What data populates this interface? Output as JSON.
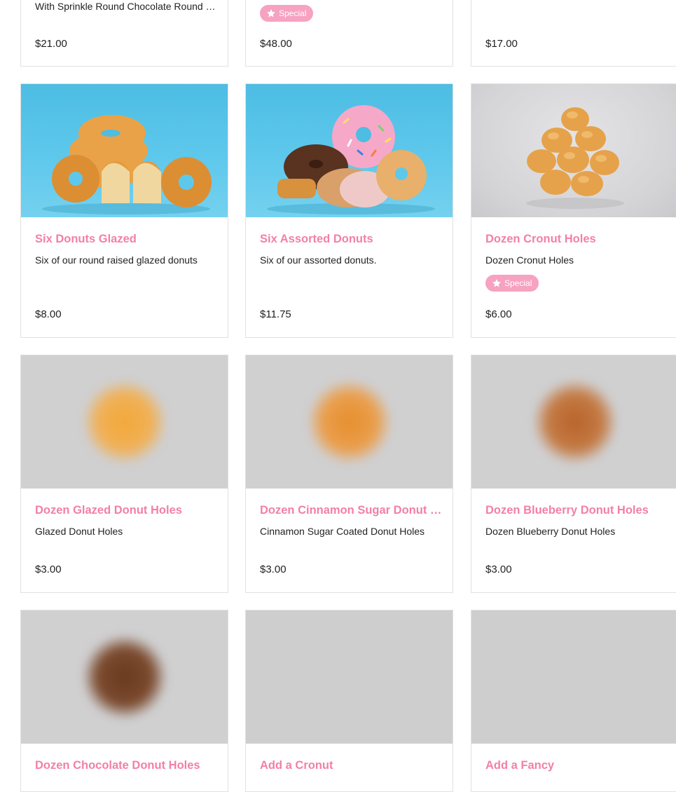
{
  "cards": {
    "c0": {
      "description": "With Sprinkle Round Chocolate Round Glazed Donuts",
      "price": "$21.00"
    },
    "c1": {
      "badge": "Special",
      "price": "$48.00"
    },
    "c2": {
      "price": "$17.00"
    },
    "c3": {
      "title": "Six Donuts Glazed",
      "description": "Six of our round raised glazed donuts",
      "price": "$8.00",
      "image": "glazed-donuts-photo"
    },
    "c4": {
      "title": "Six Assorted Donuts",
      "description": "Six of our assorted donuts.",
      "price": "$11.75",
      "image": "assorted-donuts-photo"
    },
    "c5": {
      "title": "Dozen Cronut Holes",
      "description": "Dozen Cronut Holes",
      "badge": "Special",
      "price": "$6.00",
      "image": "cronut-holes-photo"
    },
    "c6": {
      "title": "Dozen Glazed Donut Holes",
      "description": "Glazed Donut Holes",
      "price": "$3.00",
      "image": "glazed-holes-photo-loading"
    },
    "c7": {
      "title": "Dozen Cinnamon Sugar Donut Holes",
      "description": "Cinnamon Sugar Coated Donut Holes",
      "price": "$3.00",
      "image": "cinnamon-holes-photo-loading"
    },
    "c8": {
      "title": "Dozen Blueberry Donut Holes",
      "description": "Dozen Blueberry Donut Holes",
      "price": "$3.00",
      "image": "blueberry-holes-photo-loading"
    },
    "c9": {
      "title": "Dozen Chocolate Donut Holes",
      "image": "chocolate-holes-photo-loading"
    },
    "c10": {
      "title": "Add a Cronut",
      "image": "empty-image"
    },
    "c11": {
      "title": "Add a Fancy",
      "image": "empty-image"
    }
  },
  "colors": {
    "title": "#f37fa8",
    "badge": "#f6a2c0",
    "border": "#e1e1e1"
  },
  "icons": {
    "badge": "star-icon"
  }
}
